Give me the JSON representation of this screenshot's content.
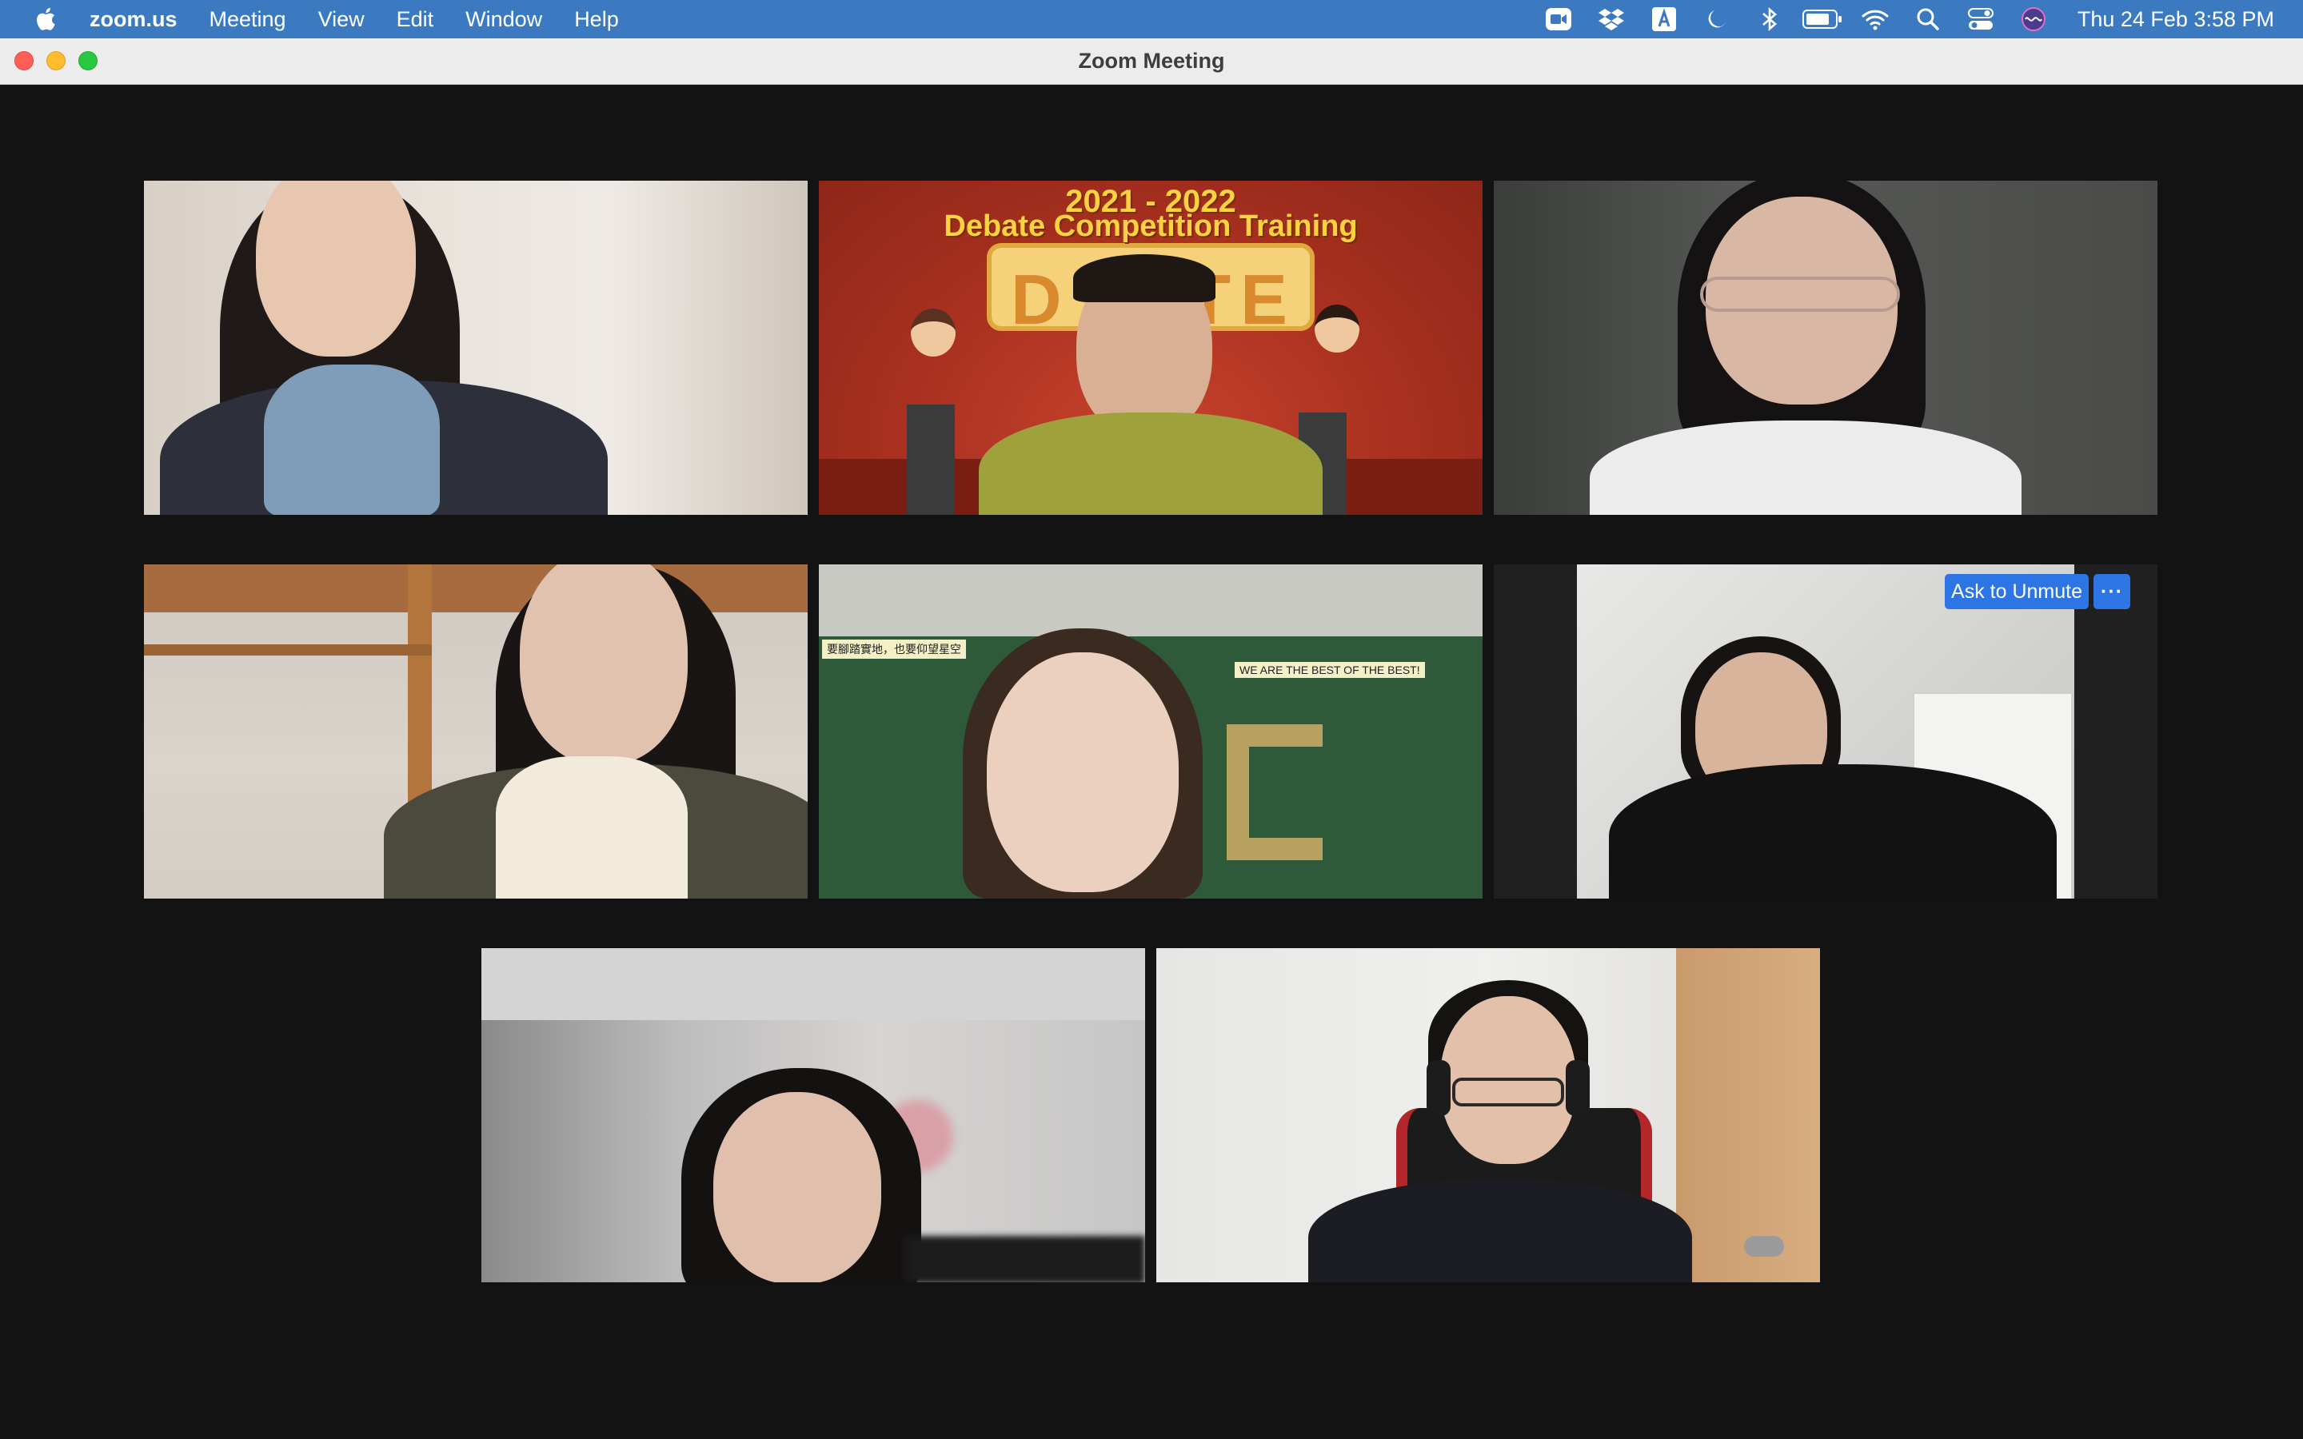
{
  "menubar": {
    "app_name": "zoom.us",
    "items": [
      "Meeting",
      "View",
      "Edit",
      "Window",
      "Help"
    ],
    "clock": "Thu 24 Feb  3:58 PM"
  },
  "window": {
    "title": "Zoom Meeting"
  },
  "tiles": {
    "banner_year": "2021 - 2022",
    "banner_subtitle": "Debate Competition Training",
    "board_left": "要腳踏實地，也要仰望星空",
    "board_right": "WE ARE THE BEST OF THE BEST!",
    "ask_to_unmute": "Ask to Unmute",
    "more": "···"
  },
  "colors": {
    "menubar": "#3b7ac0",
    "active_speaker_border": "#5ad55a",
    "button_blue": "#2d74e4"
  }
}
